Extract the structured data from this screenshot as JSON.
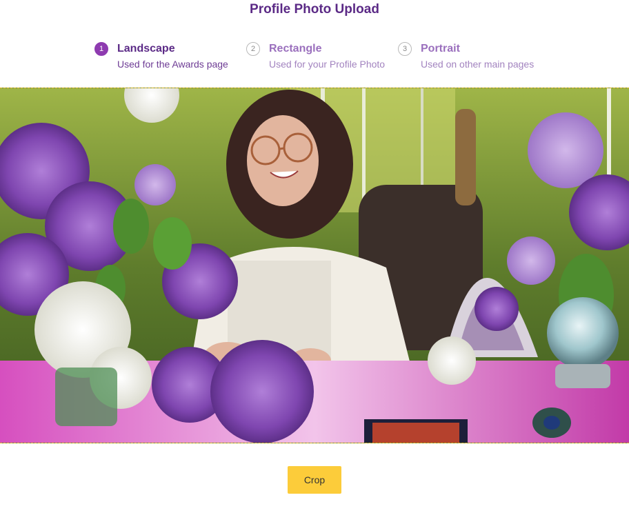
{
  "page": {
    "title": "Profile Photo Upload"
  },
  "steps": [
    {
      "number": "1",
      "label": "Landscape",
      "description": "Used for the Awards page",
      "active": true
    },
    {
      "number": "2",
      "label": "Rectangle",
      "description": "Used for your Profile Photo",
      "active": false
    },
    {
      "number": "3",
      "label": "Portrait",
      "description": "Used on other main pages",
      "active": false
    }
  ],
  "photo": {
    "subject": "woman-with-lilacs-and-crystal-ball"
  },
  "actions": {
    "crop_label": "Crop"
  },
  "colors": {
    "title_purple": "#5b2a86",
    "active_step": "#8e3bb0",
    "crop_button": "#fccc3a",
    "crop_border": "#d9b21e"
  }
}
